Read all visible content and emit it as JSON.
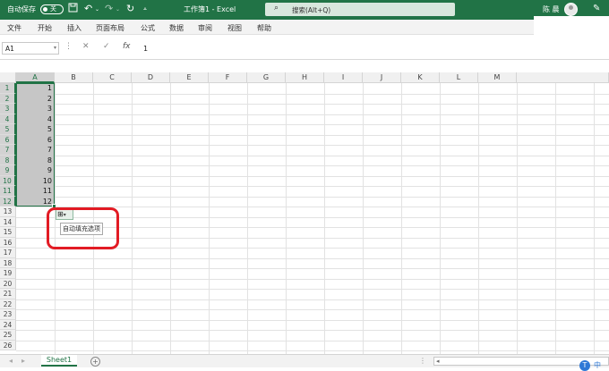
{
  "titlebar": {
    "autosave_label": "自动保存",
    "autosave_state": "关",
    "save_icon": "save-icon",
    "undo_icon": "undo-icon",
    "redo_icon": "redo-icon",
    "refresh_icon": "refresh-icon",
    "customize_icon": "customize-icon",
    "title": "工作簿1 - Excel",
    "search_placeholder": "搜索(Alt+Q)",
    "user": "陈 晨"
  },
  "menu": [
    "文件",
    "开始",
    "插入",
    "页面布局",
    "公式",
    "数据",
    "审阅",
    "视图",
    "帮助"
  ],
  "formula_bar": {
    "name_box": "A1",
    "fx": "fx",
    "value": "1"
  },
  "columns": [
    "A",
    "B",
    "C",
    "D",
    "E",
    "F",
    "G",
    "H",
    "I",
    "J",
    "K",
    "L",
    "M"
  ],
  "rows": [
    "1",
    "2",
    "3",
    "4",
    "5",
    "6",
    "7",
    "8",
    "9",
    "10",
    "11",
    "12",
    "13",
    "14",
    "15",
    "16",
    "17",
    "18",
    "19",
    "20",
    "21",
    "22",
    "23",
    "24",
    "25",
    "26"
  ],
  "cells_a": [
    "1",
    "2",
    "3",
    "4",
    "5",
    "6",
    "7",
    "8",
    "9",
    "10",
    "11",
    "12"
  ],
  "autofill": {
    "tooltip": "自动填充选项"
  },
  "sheetbar": {
    "tab": "Sheet1",
    "add": "+"
  },
  "colors": {
    "excel_green": "#217346",
    "highlight_red": "#e21b24"
  }
}
